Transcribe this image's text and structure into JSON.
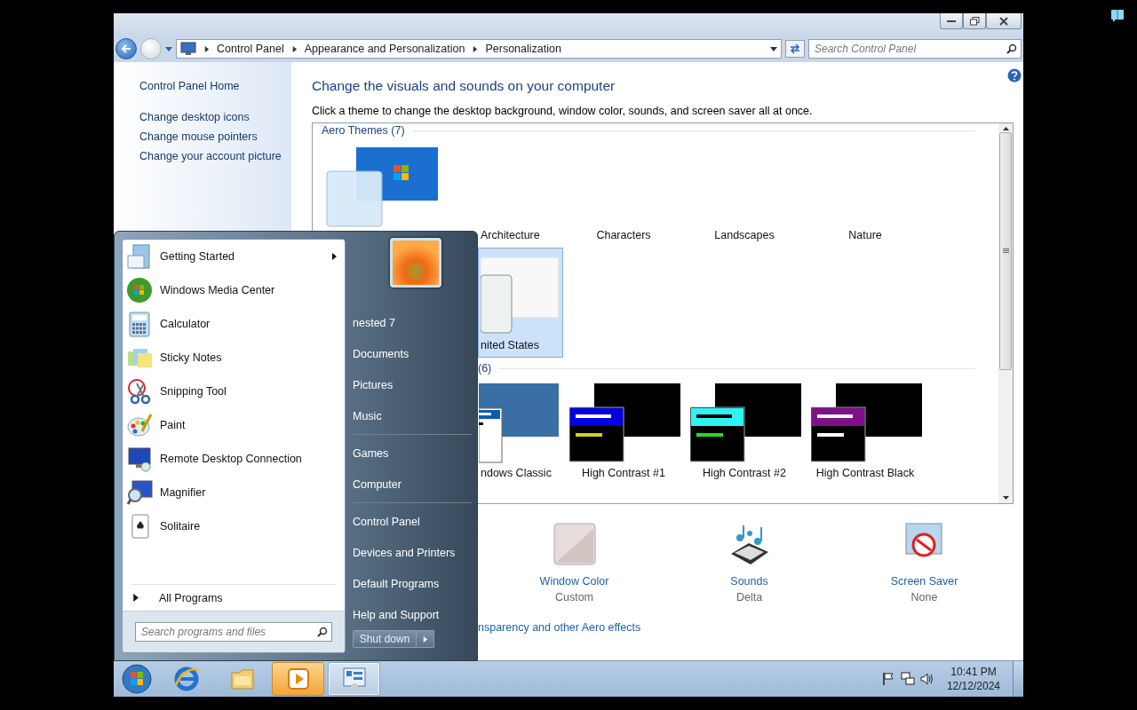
{
  "address_bar": {
    "crumbs": [
      "Control Panel",
      "Appearance and Personalization",
      "Personalization"
    ],
    "search": {
      "placeholder": "Search Control Panel"
    }
  },
  "sidebar": {
    "links": [
      "Control Panel Home",
      "Change desktop icons",
      "Change mouse pointers",
      "Change your account picture"
    ]
  },
  "main": {
    "title": "Change the visuals and sounds on your computer",
    "subtitle": "Click a theme to change the desktop background, window color, sounds, and screen saver all at once.",
    "theme_groups": [
      {
        "title": "Aero Themes (7)",
        "themes": [
          {
            "kind": "aero",
            "selected": false
          },
          {
            "label": "Architecture",
            "kind": "none",
            "selected": false
          },
          {
            "label": "Characters",
            "kind": "none",
            "selected": false
          },
          {
            "label": "Landscapes",
            "kind": "none",
            "selected": false
          },
          {
            "label": "Nature",
            "kind": "none",
            "selected": false
          },
          {
            "label": "nited States",
            "kind": "glass",
            "selected": true
          }
        ]
      },
      {
        "title": "(6)",
        "themes": [
          {
            "label": "ndows Classic",
            "kind": "classic",
            "selected": false
          },
          {
            "label": "High Contrast #1",
            "kind": "hc1",
            "selected": false
          },
          {
            "label": "High Contrast #2",
            "kind": "hc2",
            "selected": false
          },
          {
            "label": "High Contrast Black",
            "kind": "hcblack",
            "selected": false
          }
        ]
      }
    ],
    "settings": [
      {
        "kind": "window-color",
        "label": "Window Color",
        "value": "Custom"
      },
      {
        "kind": "sounds",
        "label": "Sounds",
        "value": "Delta"
      },
      {
        "kind": "screen-saver",
        "label": "Screen Saver",
        "value": "None"
      }
    ],
    "link": "nsparency and other Aero effects"
  },
  "start_menu": {
    "programs": [
      {
        "kind": "getting-started",
        "label": "Getting Started",
        "submenu": true
      },
      {
        "kind": "media-center",
        "label": "Windows Media Center",
        "submenu": false
      },
      {
        "kind": "calculator",
        "label": "Calculator",
        "submenu": false
      },
      {
        "kind": "sticky-notes",
        "label": "Sticky Notes",
        "submenu": false
      },
      {
        "kind": "snipping",
        "label": "Snipping Tool",
        "submenu": false
      },
      {
        "kind": "paint",
        "label": "Paint",
        "submenu": false
      },
      {
        "kind": "remote-desktop",
        "label": "Remote Desktop Connection",
        "submenu": false
      },
      {
        "kind": "magnifier",
        "label": "Magnifier",
        "submenu": false
      },
      {
        "kind": "solitaire",
        "label": "Solitaire",
        "submenu": false
      }
    ],
    "all_programs": "All Programs",
    "search": {
      "placeholder": "Search programs and files"
    },
    "places": [
      [
        "nested 7",
        "Documents",
        "Pictures",
        "Music"
      ],
      [
        "Games",
        "Computer"
      ],
      [
        "Control Panel",
        "Devices and Printers",
        "Default Programs",
        "Help and Support"
      ]
    ],
    "shutdown": "Shut down"
  },
  "taskbar": {
    "apps": [
      {
        "kind": "browser",
        "flashing": false,
        "open": false
      },
      {
        "kind": "folder",
        "flashing": false,
        "open": false
      },
      {
        "kind": "media",
        "flashing": true,
        "open": false
      },
      {
        "kind": "control-panel",
        "flashing": false,
        "open": true
      }
    ],
    "clock": {
      "time": "10:41 PM",
      "date": "12/12/2024"
    }
  }
}
